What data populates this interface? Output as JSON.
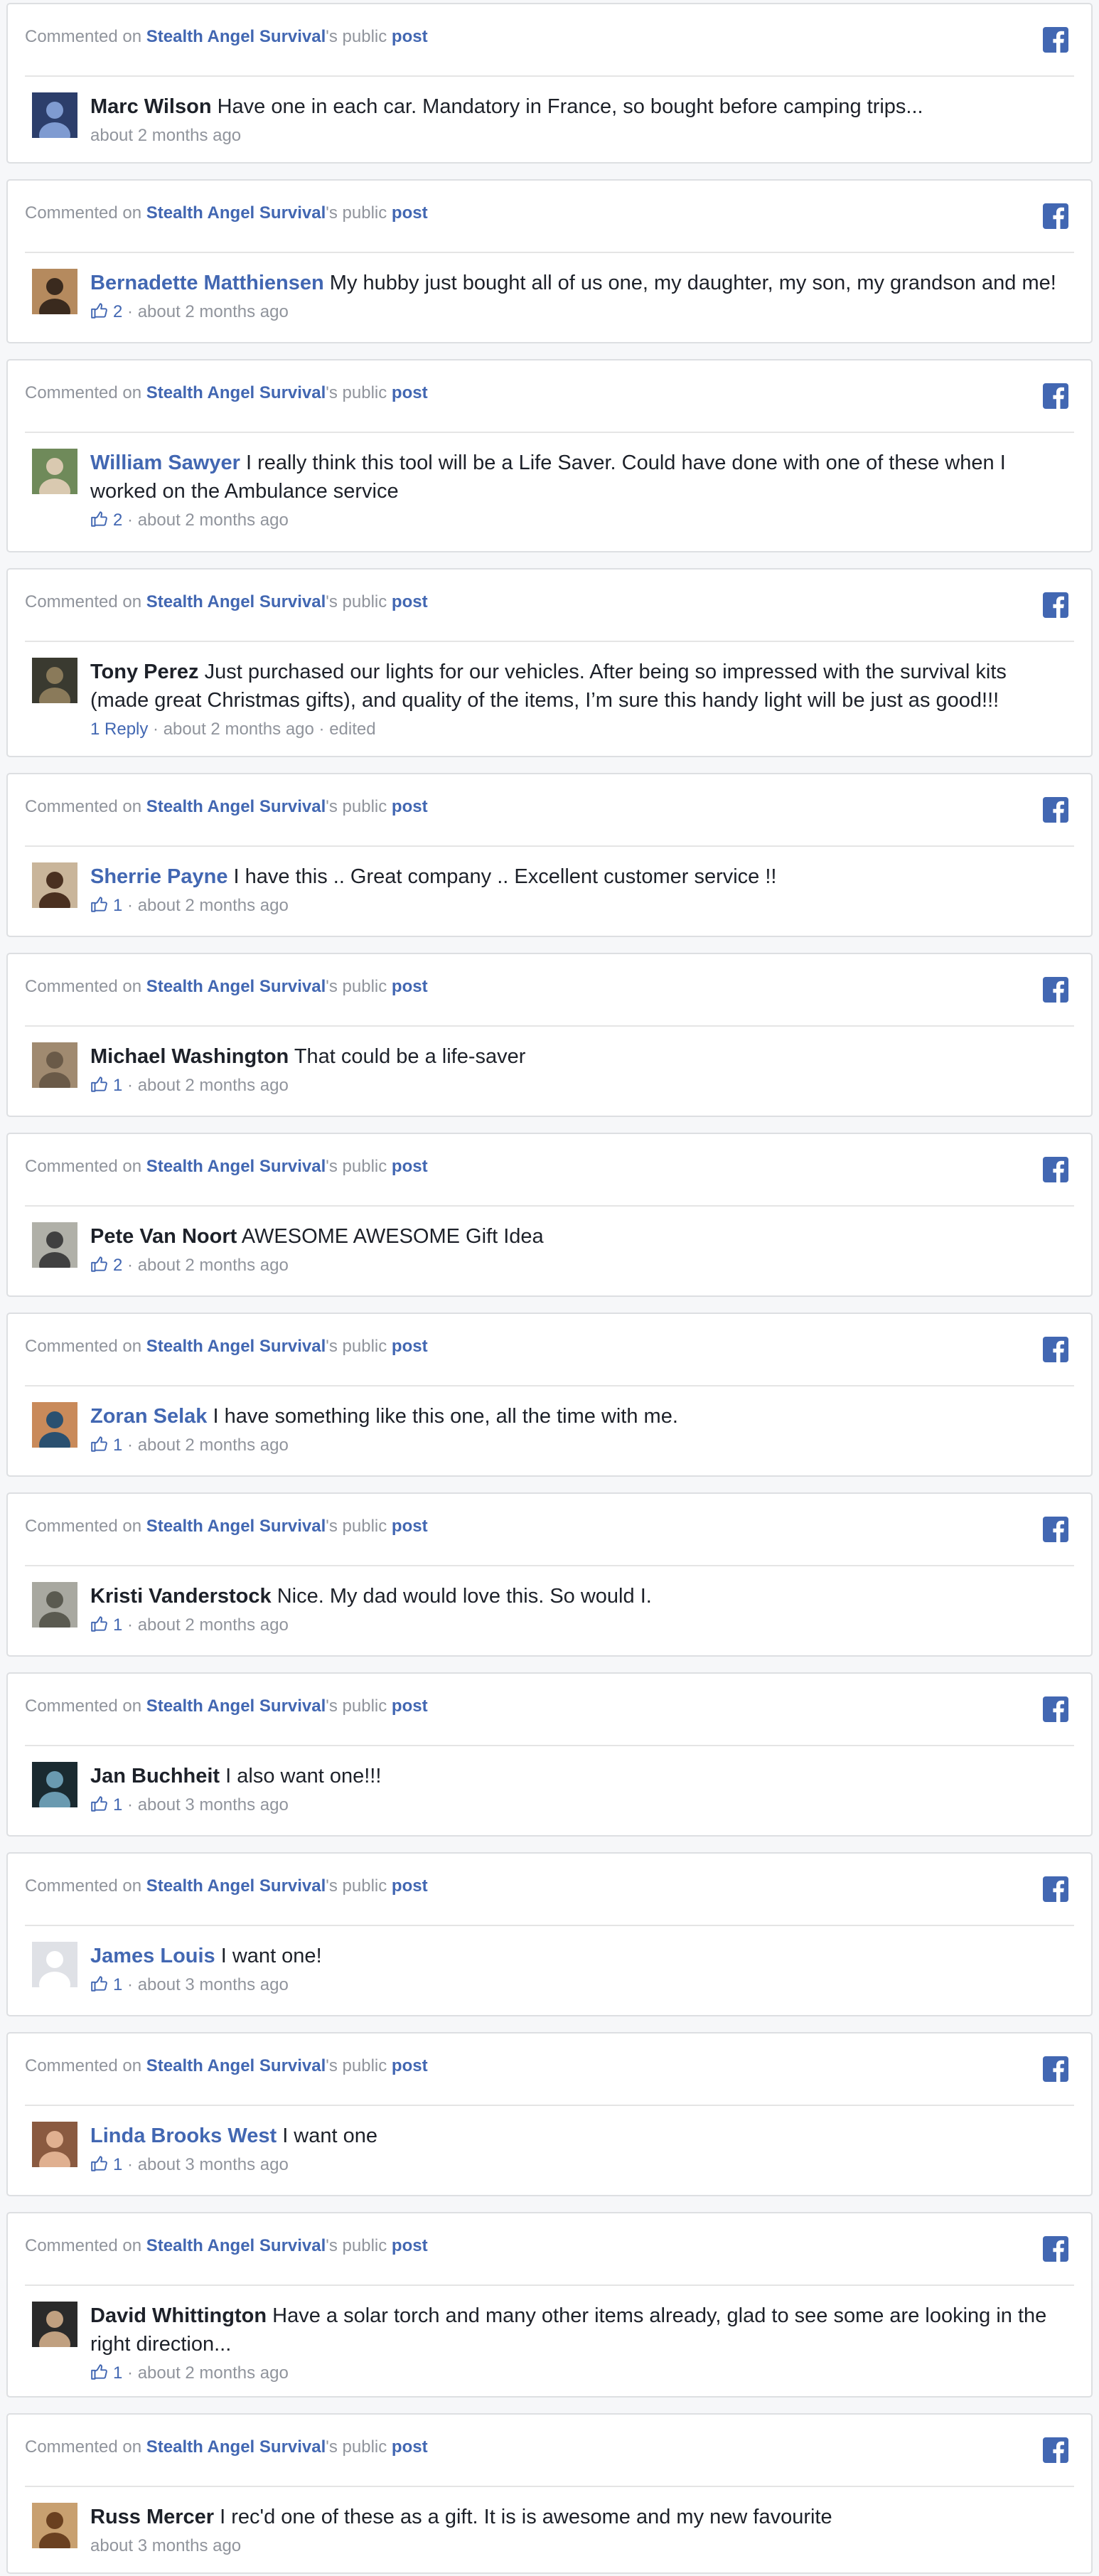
{
  "colors": {
    "link": "#4267b2",
    "muted": "#90949c",
    "text": "#1d2129",
    "border": "#dddfe2",
    "background": "#f6f7f9"
  },
  "header_template": {
    "prefix": "Commented on ",
    "page_name": "Stealth Angel Survival",
    "suffix": "'s public ",
    "post_link": "post",
    "icon": "facebook-icon"
  },
  "separator": " · ",
  "comments": [
    {
      "author": "Marc Wilson",
      "author_linked": false,
      "text": "Have one in each car. Mandatory in France, so bought before camping trips...",
      "likes": "",
      "replies": "",
      "time": "about 2 months ago",
      "edited": "",
      "avatar": {
        "bg": "#2c3e6b",
        "fg": "#7f9bd1"
      }
    },
    {
      "author": "Bernadette Matthiensen",
      "author_linked": true,
      "text": "My hubby just bought all of us one, my daughter, my son, my grandson and me!",
      "likes": "2",
      "replies": "",
      "time": "about 2 months ago",
      "edited": "",
      "avatar": {
        "bg": "#b58a5e",
        "fg": "#3a2a1e"
      }
    },
    {
      "author": "William Sawyer",
      "author_linked": true,
      "text": "I really think this tool will be a Life Saver. Could have done with one of these when I worked on the Ambulance service",
      "likes": "2",
      "replies": "",
      "time": "about 2 months ago",
      "edited": "",
      "avatar": {
        "bg": "#6f8a5a",
        "fg": "#d9c9b0"
      }
    },
    {
      "author": "Tony Perez",
      "author_linked": false,
      "text": "Just purchased our lights for our vehicles. After being so impressed with the survival kits (made great Christmas gifts), and quality of the items, I’m sure this handy light will be just as good!!!",
      "likes": "",
      "replies": "1 Reply",
      "time": "about 2 months ago",
      "edited": "edited",
      "avatar": {
        "bg": "#3a3a30",
        "fg": "#8a7a5a"
      }
    },
    {
      "author": "Sherrie Payne",
      "author_linked": true,
      "text": "I have this .. Great company .. Excellent customer service !!",
      "likes": "1",
      "replies": "",
      "time": "about 2 months ago",
      "edited": "",
      "avatar": {
        "bg": "#c9b59a",
        "fg": "#4a3020"
      }
    },
    {
      "author": "Michael Washington",
      "author_linked": false,
      "text": "That could be a life-saver",
      "likes": "1",
      "replies": "",
      "time": "about 2 months ago",
      "edited": "",
      "avatar": {
        "bg": "#a08a70",
        "fg": "#6a5a48"
      }
    },
    {
      "author": "Pete Van Noort",
      "author_linked": false,
      "text": "AWESOME AWESOME Gift Idea",
      "likes": "2",
      "replies": "",
      "time": "about 2 months ago",
      "edited": "",
      "avatar": {
        "bg": "#b0b0a8",
        "fg": "#404040"
      }
    },
    {
      "author": "Zoran Selak",
      "author_linked": true,
      "text": "I have something like this one, all the time with me.",
      "likes": "1",
      "replies": "",
      "time": "about 2 months ago",
      "edited": "",
      "avatar": {
        "bg": "#c98a5a",
        "fg": "#2a5070"
      }
    },
    {
      "author": "Kristi Vanderstock",
      "author_linked": false,
      "text": "Nice. My dad would love this. So would I.",
      "likes": "1",
      "replies": "",
      "time": "about 2 months ago",
      "edited": "",
      "avatar": {
        "bg": "#a8a8a0",
        "fg": "#5a5a50"
      }
    },
    {
      "author": "Jan Buchheit",
      "author_linked": false,
      "text": "I also want one!!!",
      "likes": "1",
      "replies": "",
      "time": "about 3 months ago",
      "edited": "",
      "avatar": {
        "bg": "#1a2a30",
        "fg": "#6a9ab0"
      }
    },
    {
      "author": "James Louis",
      "author_linked": true,
      "text": "I want one!",
      "likes": "1",
      "replies": "",
      "time": "about 3 months ago",
      "edited": "",
      "avatar": {
        "bg": "#dfe1e6",
        "fg": "#ffffff"
      }
    },
    {
      "author": "Linda Brooks West",
      "author_linked": true,
      "text": "I want one",
      "likes": "1",
      "replies": "",
      "time": "about 3 months ago",
      "edited": "",
      "avatar": {
        "bg": "#8a5a40",
        "fg": "#e0b090"
      }
    },
    {
      "author": "David Whittington",
      "author_linked": false,
      "text": "Have a solar torch and many other items already, glad to see some are looking in the right direction...",
      "likes": "1",
      "replies": "",
      "time": "about 2 months ago",
      "edited": "",
      "avatar": {
        "bg": "#2a2a2a",
        "fg": "#c0a080"
      }
    },
    {
      "author": "Russ Mercer",
      "author_linked": false,
      "text": "I rec'd one of these as a gift. It is is awesome and my new favourite",
      "likes": "",
      "replies": "",
      "time": "about 3 months ago",
      "edited": "",
      "avatar": {
        "bg": "#c8a070",
        "fg": "#6a4020"
      }
    }
  ]
}
